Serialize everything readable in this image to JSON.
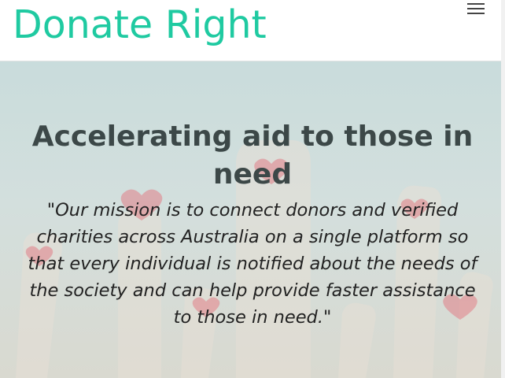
{
  "header": {
    "brand": "Donate Right",
    "menu_icon": "hamburger-menu-icon"
  },
  "hero": {
    "headline": "Accelerating aid to those in need",
    "mission": "\"Our mission is to connect donors and verified charities across Australia on a single platform so that every individual is notified about the needs of the society and can help provide faster assistance to those in need.\"",
    "background_image": "raised hands with hearts"
  },
  "colors": {
    "brand": "#1fcaa1",
    "headline": "#3c4848",
    "heart": "#e07e86"
  }
}
